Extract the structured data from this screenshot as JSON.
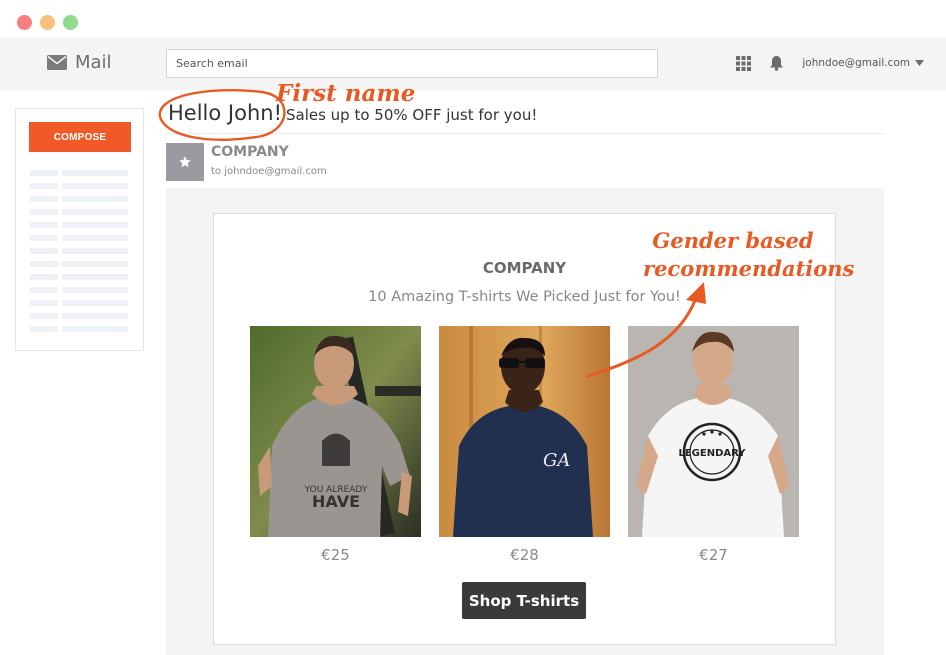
{
  "app": {
    "name": "Mail"
  },
  "search": {
    "placeholder": "Search email"
  },
  "header": {
    "user_email": "johndoe@gmail.com"
  },
  "sidebar": {
    "compose_label": "COMPOSE"
  },
  "message": {
    "greeting": "Hello John!",
    "subject": "Sales up to 50% OFF just for you!",
    "sender": "COMPANY",
    "to": "to johndoe@gmail.com"
  },
  "email_body": {
    "company": "COMPANY",
    "tagline": "10 Amazing T-shirts We Picked Just for You!",
    "products": [
      {
        "price": "€25",
        "shirt_color": "#9a9590"
      },
      {
        "price": "€28",
        "shirt_color": "#22304f"
      },
      {
        "price": "€27",
        "shirt_color": "#f5f5f5"
      }
    ],
    "cta_label": "Shop T-shirts"
  },
  "annotations": {
    "first_name": "First name",
    "gender_line1": "Gender based",
    "gender_line2": "recommendations"
  },
  "colors": {
    "accent": "#f05a28",
    "annotation": "#e85a22",
    "button": "#3a3a3c"
  }
}
